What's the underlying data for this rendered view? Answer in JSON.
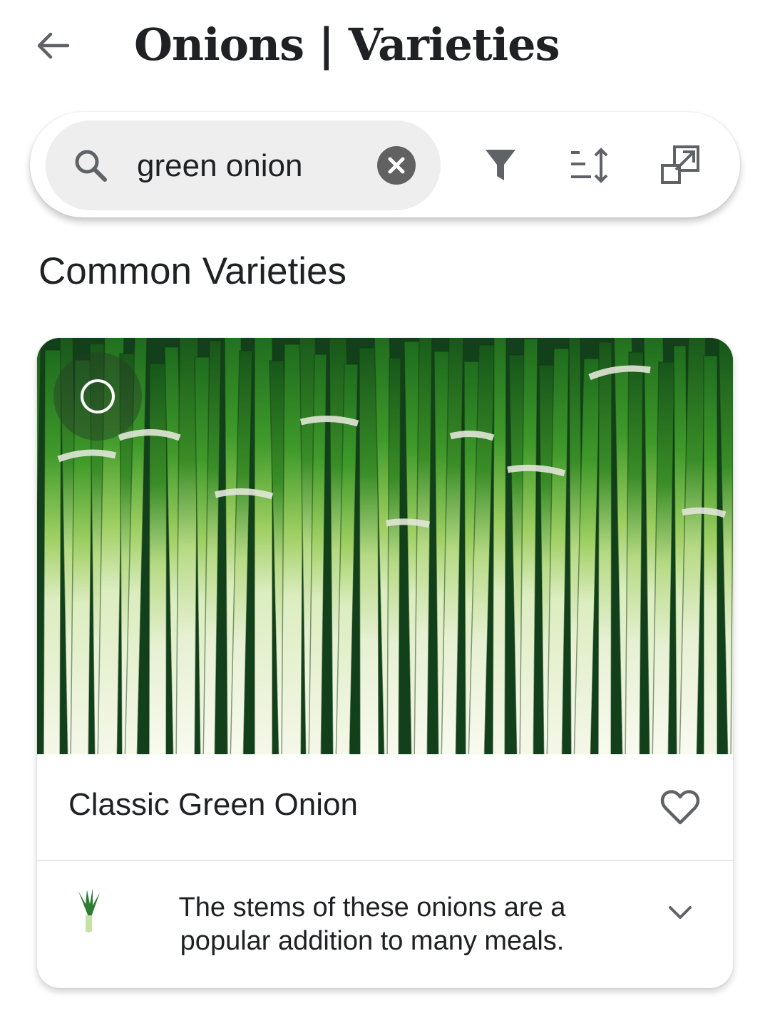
{
  "header": {
    "title": "Onions | Varieties",
    "back_icon": "arrow-left-icon"
  },
  "search": {
    "value": "green onion",
    "placeholder": "",
    "icon": "search-icon",
    "clear_icon": "clear-icon"
  },
  "toolbar": {
    "icons": [
      "filter-icon",
      "sort-icon",
      "open-external-icon"
    ]
  },
  "section": {
    "title": "Common Varieties"
  },
  "card": {
    "name": "Classic Green Onion",
    "description": "The stems of these onions are a popular addition to many meals.",
    "selected": false,
    "favorite": false
  },
  "colors": {
    "accent_dark": "#5f6368",
    "clear_button": "#616161",
    "search_bg": "#eeeeee",
    "leaf_green": "#2e7d32"
  }
}
